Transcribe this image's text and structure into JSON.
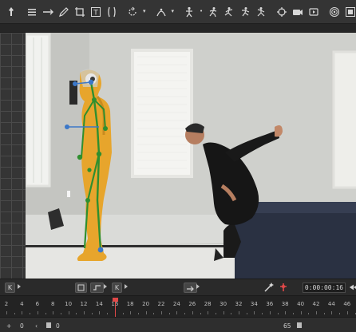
{
  "toolbar": {
    "icons": [
      "pin-icon",
      "list-icon",
      "arrow-range-icon",
      "pencil-tool-icon",
      "crop-icon",
      "text-tool-icon",
      "bracket-icon",
      "rotate-icon",
      "skeleton-tool-icon",
      "pose-icon",
      "run-pose-a-icon",
      "run-pose-b-icon",
      "run-pose-c-icon",
      "run-pose-d-icon",
      "target-icon",
      "camera-icon",
      "video-icon",
      "spiral-icon",
      "grid-icon",
      "export-icon"
    ],
    "text_icon_glyph": "T"
  },
  "playbar": {
    "btn_a_label": "K",
    "btn_b_label": "K",
    "timecode": "0:00:00:16"
  },
  "timeline": {
    "ticks": [
      "2",
      "4",
      "6",
      "8",
      "10",
      "12",
      "14",
      "16",
      "18",
      "20",
      "22",
      "24",
      "26",
      "28",
      "30",
      "32",
      "34",
      "36",
      "38",
      "40",
      "42",
      "44",
      "46"
    ],
    "current_frame": 16,
    "start_label": "0",
    "range_start": "0",
    "range_end": "65"
  },
  "colors": {
    "accent": "#e04848",
    "skeleton": "#2f8f2f",
    "figure": "#e7a52c",
    "joint": "#3c78c8"
  }
}
